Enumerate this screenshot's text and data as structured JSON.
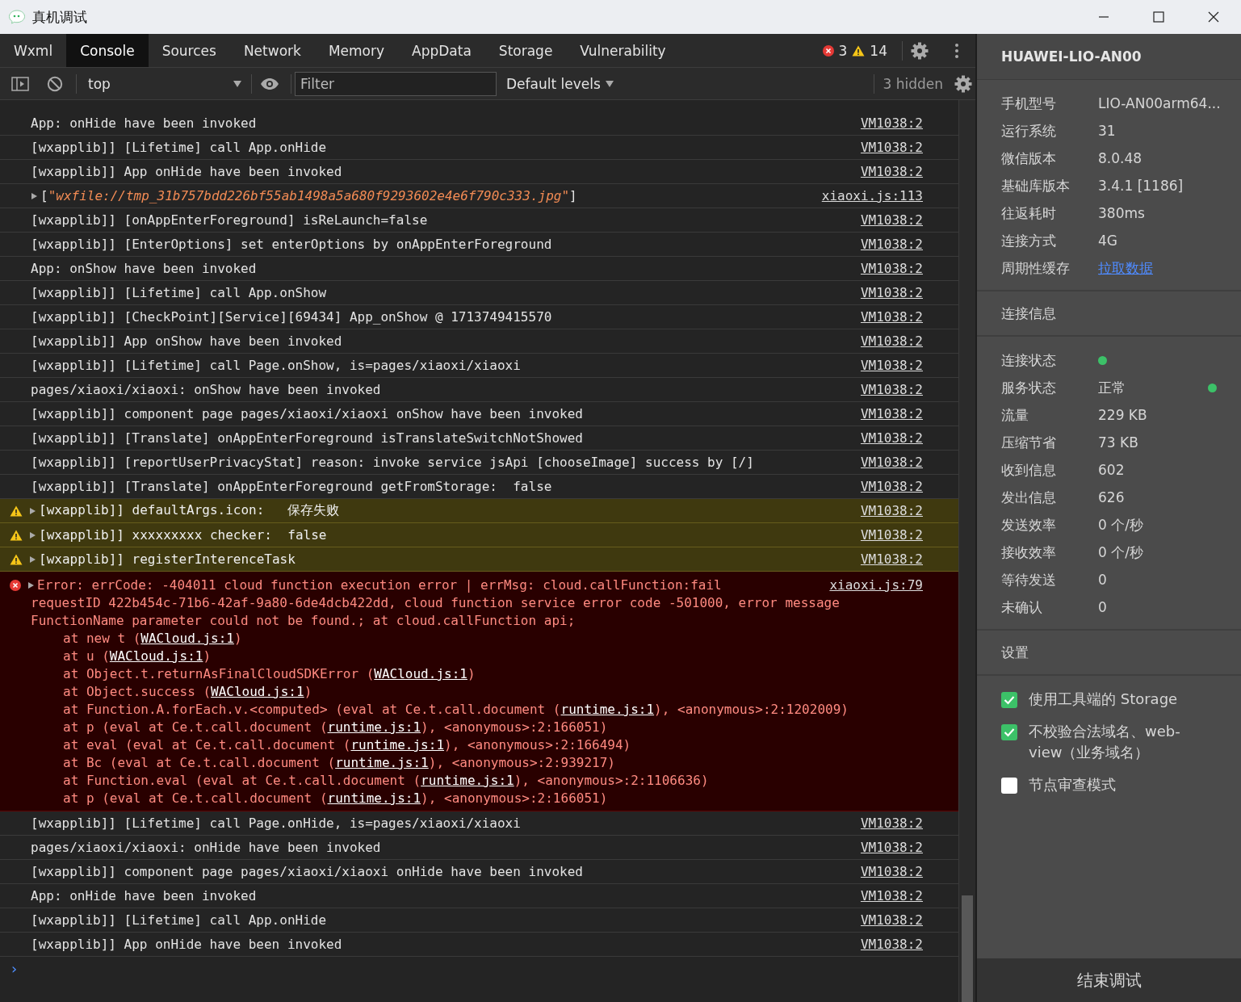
{
  "window": {
    "title": "真机调试"
  },
  "tabs": [
    {
      "label": "Wxml",
      "selected": false
    },
    {
      "label": "Console",
      "selected": true
    },
    {
      "label": "Sources",
      "selected": false
    },
    {
      "label": "Network",
      "selected": false
    },
    {
      "label": "Memory",
      "selected": false
    },
    {
      "label": "AppData",
      "selected": false
    },
    {
      "label": "Storage",
      "selected": false
    },
    {
      "label": "Vulnerability",
      "selected": false
    }
  ],
  "counters": {
    "errors": "3",
    "warnings": "14"
  },
  "toolbar": {
    "context": "top",
    "filter": {
      "placeholder": "Filter"
    },
    "levels": "Default levels",
    "hidden": "3 hidden"
  },
  "log": [
    {
      "kind": "log",
      "text": "App: onHide have been invoked",
      "source": "VM1038:2"
    },
    {
      "kind": "log",
      "text": "[wxapplib]] [Lifetime] call App.onHide",
      "source": "VM1038:2"
    },
    {
      "kind": "log",
      "text": "[wxapplib]] App onHide have been invoked",
      "source": "VM1038:2"
    },
    {
      "kind": "array",
      "open": "[",
      "value": "\"wxfile://tmp_31b757bdd226bf55ab1498a5a680f9293602e4e6f790c333.jpg\"",
      "close": "]",
      "expanded": false,
      "source": "xiaoxi.js:113"
    },
    {
      "kind": "log",
      "text": "[wxapplib]] [onAppEnterForeground] isReLaunch=false",
      "source": "VM1038:2"
    },
    {
      "kind": "log",
      "text": "[wxapplib]] [EnterOptions] set enterOptions by onAppEnterForeground",
      "source": "VM1038:2"
    },
    {
      "kind": "log",
      "text": "App: onShow have been invoked",
      "source": "VM1038:2"
    },
    {
      "kind": "log",
      "text": "[wxapplib]] [Lifetime] call App.onShow",
      "source": "VM1038:2"
    },
    {
      "kind": "log",
      "text": "[wxapplib]] [CheckPoint][Service][69434] App_onShow @ 1713749415570",
      "source": "VM1038:2"
    },
    {
      "kind": "log",
      "text": "[wxapplib]] App onShow have been invoked",
      "source": "VM1038:2"
    },
    {
      "kind": "log",
      "text": "[wxapplib]] [Lifetime] call Page.onShow, is=pages/xiaoxi/xiaoxi",
      "source": "VM1038:2"
    },
    {
      "kind": "log",
      "text": "pages/xiaoxi/xiaoxi: onShow have been invoked",
      "source": "VM1038:2"
    },
    {
      "kind": "log",
      "text": "[wxapplib]] component page pages/xiaoxi/xiaoxi onShow have been invoked",
      "source": "VM1038:2"
    },
    {
      "kind": "log",
      "text": "[wxapplib]] [Translate] onAppEnterForeground isTranslateSwitchNotShowed",
      "source": "VM1038:2"
    },
    {
      "kind": "log",
      "text": "[wxapplib]] [reportUserPrivacyStat] reason: invoke service jsApi [chooseImage] success by [/]",
      "source": "VM1038:2"
    },
    {
      "kind": "log",
      "text": "[wxapplib]] [Translate] onAppEnterForeground getFromStorage:  false",
      "source": "VM1038:2"
    },
    {
      "kind": "warn",
      "text": "[wxapplib]] defaultArgs.icon:   保存失败",
      "expanded": false,
      "source": "VM1038:2"
    },
    {
      "kind": "warn",
      "text": "[wxapplib]] xxxxxxxxx checker:  false",
      "expanded": false,
      "source": "VM1038:2"
    },
    {
      "kind": "warn",
      "text": "[wxapplib]] registerInterenceTask",
      "expanded": false,
      "source": "VM1038:2"
    },
    {
      "kind": "error",
      "expanded": false,
      "source": "xiaoxi.js:79",
      "lines": [
        "Error: errCode: -404011 cloud function execution error | errMsg: cloud.callFunction:fail",
        "requestID 422b454c-71b6-42af-9a80-6de4dcb422dd, cloud function service error code -501000, error message",
        "FunctionName parameter could not be found.; at cloud.callFunction api;"
      ],
      "stack": [
        {
          "before": "at new t (",
          "link": "WACloud.js:1",
          "after": ")"
        },
        {
          "before": "at u (",
          "link": "WACloud.js:1",
          "after": ")"
        },
        {
          "before": "at Object.t.returnAsFinalCloudSDKError (",
          "link": "WACloud.js:1",
          "after": ")"
        },
        {
          "before": "at Object.success (",
          "link": "WACloud.js:1",
          "after": ")"
        },
        {
          "before": "at Function.A.forEach.v.<computed> (eval at Ce.t.call.document (",
          "link": "runtime.js:1",
          "after": "), <anonymous>:2:1202009)"
        },
        {
          "before": "at p (eval at Ce.t.call.document (",
          "link": "runtime.js:1",
          "after": "), <anonymous>:2:166051)"
        },
        {
          "before": "at eval (eval at Ce.t.call.document (",
          "link": "runtime.js:1",
          "after": "), <anonymous>:2:166494)"
        },
        {
          "before": "at Bc (eval at Ce.t.call.document (",
          "link": "runtime.js:1",
          "after": "), <anonymous>:2:939217)"
        },
        {
          "before": "at Function.eval (eval at Ce.t.call.document (",
          "link": "runtime.js:1",
          "after": "), <anonymous>:2:1106636)"
        },
        {
          "before": "at p (eval at Ce.t.call.document (",
          "link": "runtime.js:1",
          "after": "), <anonymous>:2:166051)"
        }
      ]
    },
    {
      "kind": "log",
      "text": "[wxapplib]] [Lifetime] call Page.onHide, is=pages/xiaoxi/xiaoxi",
      "source": "VM1038:2"
    },
    {
      "kind": "log",
      "text": "pages/xiaoxi/xiaoxi: onHide have been invoked",
      "source": "VM1038:2"
    },
    {
      "kind": "log",
      "text": "[wxapplib]] component page pages/xiaoxi/xiaoxi onHide have been invoked",
      "source": "VM1038:2"
    },
    {
      "kind": "log",
      "text": "App: onHide have been invoked",
      "source": "VM1038:2"
    },
    {
      "kind": "log",
      "text": "[wxapplib]] [Lifetime] call App.onHide",
      "source": "VM1038:2"
    },
    {
      "kind": "log",
      "text": "[wxapplib]] App onHide have been invoked",
      "source": "VM1038:2"
    }
  ],
  "prompt": "›",
  "device": {
    "name": "HUAWEI-LIO-AN00",
    "info": [
      {
        "label": "手机型号",
        "value": "LIO-AN00arm64...",
        "kind": "text"
      },
      {
        "label": "运行系统",
        "value": "31",
        "kind": "text"
      },
      {
        "label": "微信版本",
        "value": "8.0.48",
        "kind": "text"
      },
      {
        "label": "基础库版本",
        "value": "3.4.1 [1186]",
        "kind": "text"
      },
      {
        "label": "往返耗时",
        "value": "380ms",
        "kind": "text"
      },
      {
        "label": "连接方式",
        "value": "4G",
        "kind": "text"
      },
      {
        "label": "周期性缓存",
        "value": "拉取数据",
        "kind": "link"
      }
    ]
  },
  "connection": {
    "title": "连接信息",
    "rows": [
      {
        "label": "连接状态",
        "kind": "dot",
        "color": "#3cc168"
      },
      {
        "label": "服务状态",
        "kind": "status",
        "value": "正常",
        "color": "#3cc168"
      },
      {
        "label": "流量",
        "kind": "text",
        "value": "229 KB"
      },
      {
        "label": "压缩节省",
        "kind": "text",
        "value": "73 KB"
      },
      {
        "label": "收到信息",
        "kind": "text",
        "value": "602"
      },
      {
        "label": "发出信息",
        "kind": "text",
        "value": "626"
      },
      {
        "label": "发送效率",
        "kind": "text",
        "value": "0 个/秒"
      },
      {
        "label": "接收效率",
        "kind": "text",
        "value": "0 个/秒"
      },
      {
        "label": "等待发送",
        "kind": "text",
        "value": "0"
      },
      {
        "label": "未确认",
        "kind": "text",
        "value": "0"
      }
    ]
  },
  "settings": {
    "title": "设置",
    "options": [
      {
        "label": "使用工具端的 Storage",
        "checked": true
      },
      {
        "label": "不校验合法域名、web-view（业务域名）",
        "checked": true
      },
      {
        "label": "节点审查模式",
        "checked": false
      }
    ]
  },
  "end_button": "结束调试"
}
